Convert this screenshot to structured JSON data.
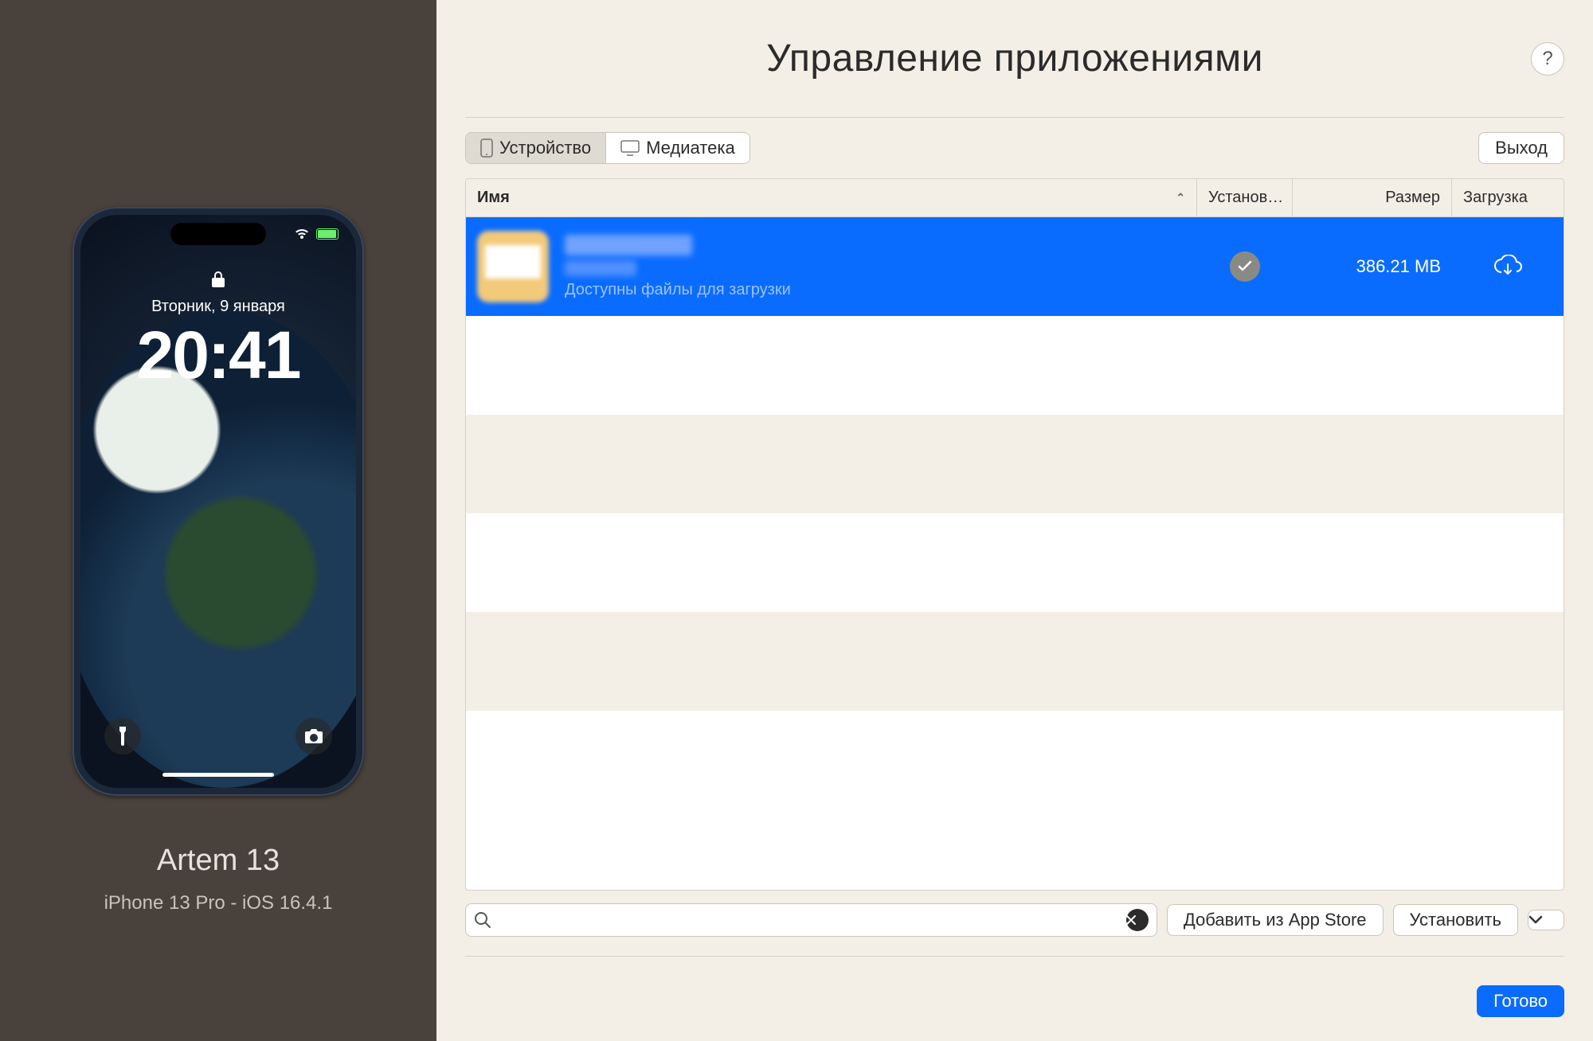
{
  "sidebar": {
    "device_name": "Artem 13",
    "device_subtitle": "iPhone 13 Pro - iOS 16.4.1",
    "lockscreen": {
      "date": "Вторник, 9 января",
      "time": "20:41"
    }
  },
  "header": {
    "title": "Управление приложениями",
    "help_label": "?"
  },
  "tabs": {
    "device": "Устройство",
    "library": "Медиатека",
    "active": "device"
  },
  "toolbar": {
    "logout": "Выход"
  },
  "columns": {
    "name": "Имя",
    "installed": "Установ…",
    "size": "Размер",
    "download": "Загрузка",
    "sort_glyph": "⌃"
  },
  "apps": [
    {
      "name": "████",
      "version": "████",
      "note": "Доступны файлы для загрузки",
      "installed": true,
      "size": "386.21 MB",
      "selected": true
    }
  ],
  "search": {
    "placeholder": "",
    "value": ""
  },
  "actions": {
    "add_from_store": "Добавить из App Store",
    "install": "Установить",
    "done": "Готово"
  }
}
